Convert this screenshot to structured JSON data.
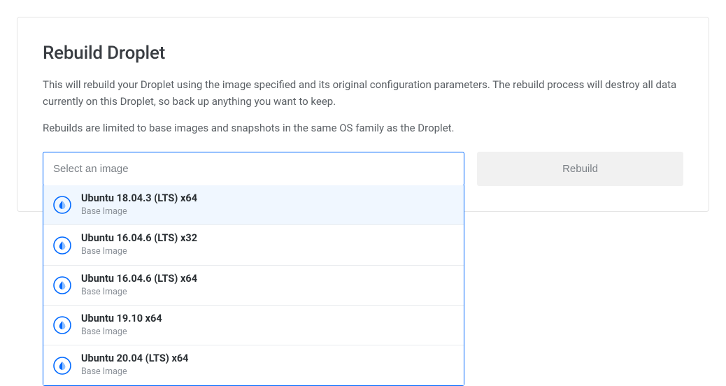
{
  "title": "Rebuild Droplet",
  "description": "This will rebuild your Droplet using the image specified and its original configuration parameters. The rebuild process will destroy all data currently on this Droplet, so back up anything you want to keep.",
  "limit_note": "Rebuilds are limited to base images and snapshots in the same OS family as the Droplet.",
  "select": {
    "placeholder": "Select an image",
    "value": ""
  },
  "rebuild_label": "Rebuild",
  "options": [
    {
      "name": "Ubuntu 18.04.3 (LTS) x64",
      "type": "Base Image",
      "highlighted": true
    },
    {
      "name": "Ubuntu 16.04.6 (LTS) x32",
      "type": "Base Image",
      "highlighted": false
    },
    {
      "name": "Ubuntu 16.04.6 (LTS) x64",
      "type": "Base Image",
      "highlighted": false
    },
    {
      "name": "Ubuntu 19.10 x64",
      "type": "Base Image",
      "highlighted": false
    },
    {
      "name": "Ubuntu 20.04 (LTS) x64",
      "type": "Base Image",
      "highlighted": false
    }
  ]
}
